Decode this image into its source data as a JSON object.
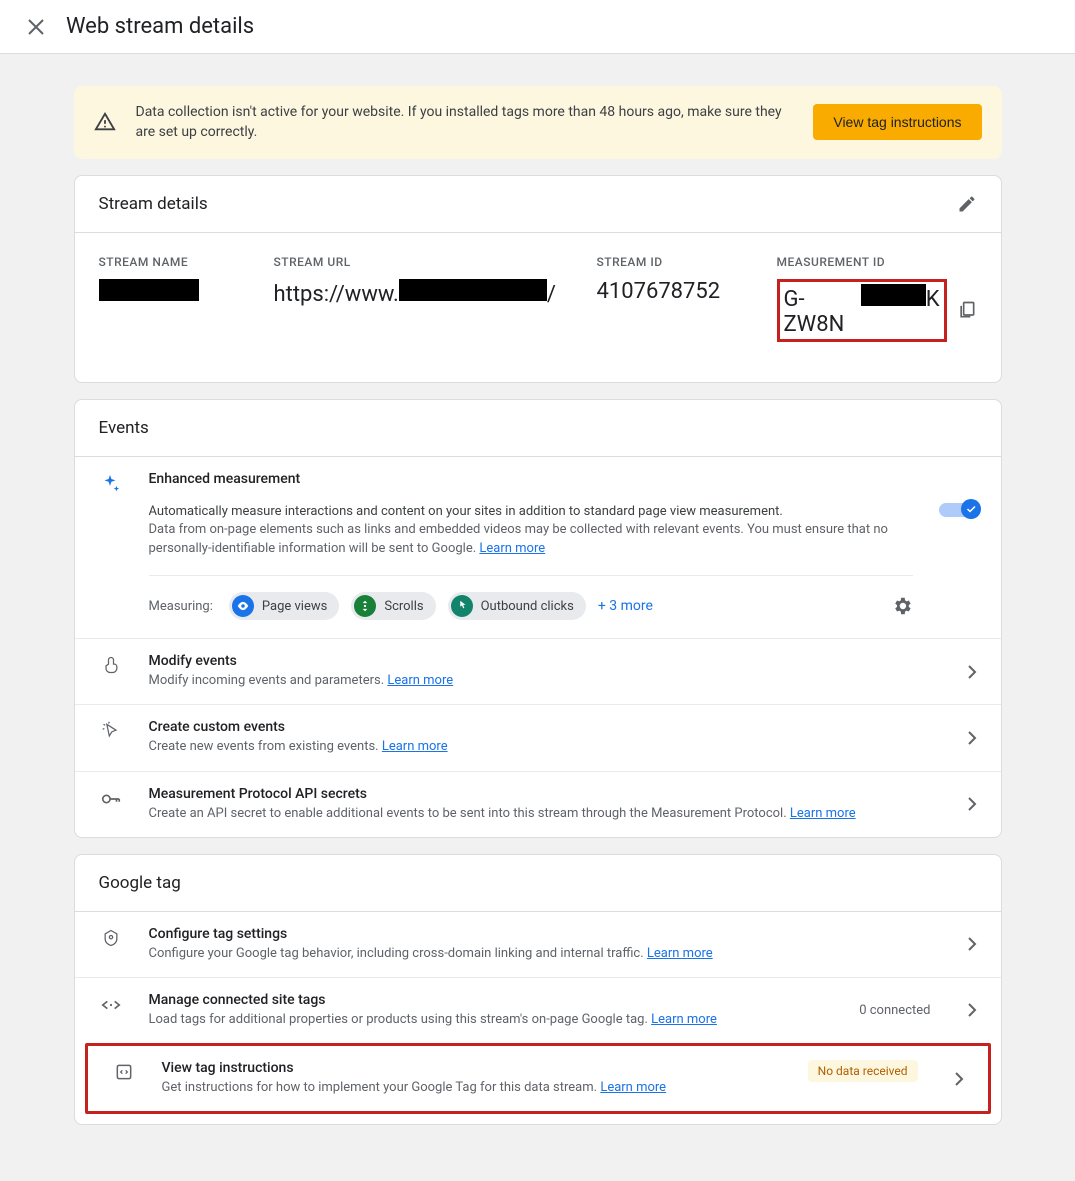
{
  "header": {
    "title": "Web stream details"
  },
  "alert": {
    "text": "Data collection isn't active for your website. If you installed tags more than 48 hours ago, make sure they are set up correctly.",
    "button": "View tag instructions"
  },
  "streamDetails": {
    "title": "Stream details",
    "labels": {
      "name": "STREAM NAME",
      "url": "STREAM URL",
      "id": "STREAM ID",
      "mid": "MEASUREMENT ID"
    },
    "urlPrefix": "https://www.",
    "urlSuffix": "/",
    "streamId": "4107678752",
    "midPrefix": "G-ZW8N",
    "midSuffix": "K"
  },
  "events": {
    "title": "Events",
    "enhanced": {
      "title": "Enhanced measurement",
      "line1": "Automatically measure interactions and content on your sites in addition to standard page view measurement.",
      "line2": "Data from on-page elements such as links and embedded videos may be collected with relevant events. You must ensure that no personally-identifiable information will be sent to Google. ",
      "learn": "Learn more",
      "measuringLabel": "Measuring:",
      "chips": [
        "Page views",
        "Scrolls",
        "Outbound clicks"
      ],
      "more": "+ 3 more"
    },
    "rows": [
      {
        "title": "Modify events",
        "desc": "Modify incoming events and parameters. ",
        "learn": "Learn more"
      },
      {
        "title": "Create custom events",
        "desc": "Create new events from existing events. ",
        "learn": "Learn more"
      },
      {
        "title": "Measurement Protocol API secrets",
        "desc": "Create an API secret to enable additional events to be sent into this stream through the Measurement Protocol. ",
        "learn": "Learn more"
      }
    ]
  },
  "googleTag": {
    "title": "Google tag",
    "rows": [
      {
        "title": "Configure tag settings",
        "desc": "Configure your Google tag behavior, including cross-domain linking and internal traffic. ",
        "learn": "Learn more"
      },
      {
        "title": "Manage connected site tags",
        "desc": "Load tags for additional properties or products using this stream's on-page Google tag. ",
        "learn": "Learn more",
        "meta": "0 connected"
      },
      {
        "title": "View tag instructions",
        "desc": "Get instructions for how to implement your Google Tag for this data stream. ",
        "learn": "Learn more",
        "badge": "No data received"
      }
    ]
  }
}
